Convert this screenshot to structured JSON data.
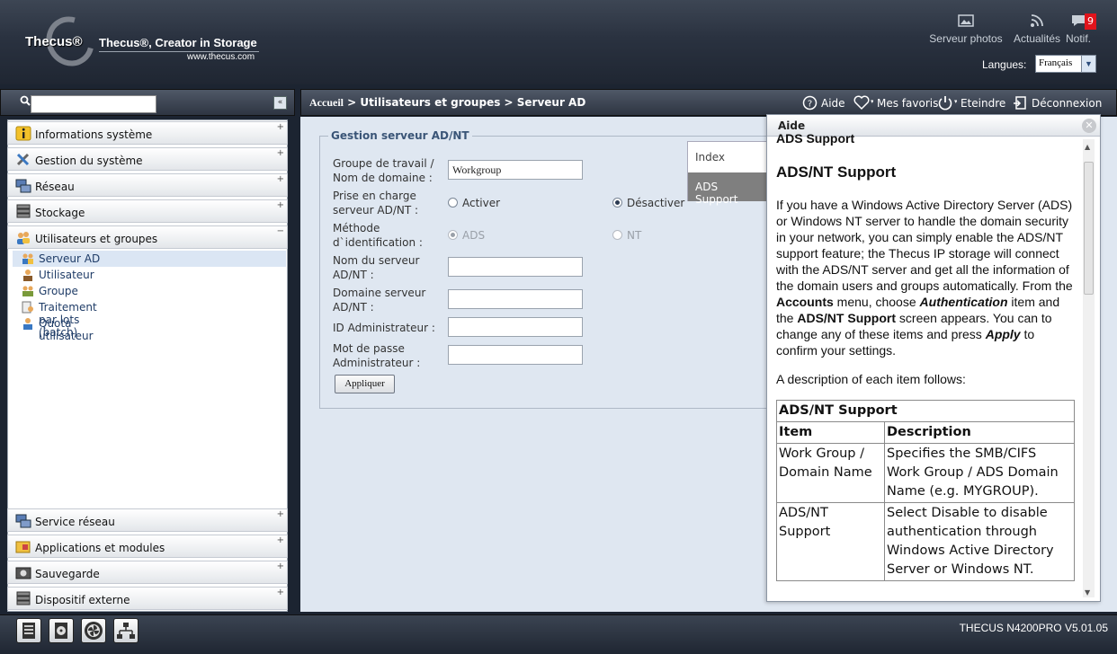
{
  "header": {
    "logo": "Thecus®",
    "tagline": "Thecus®, Creator in Storage",
    "website": "www.thecus.com",
    "photos_label": "Serveur photos",
    "news_label": "Actualités",
    "notif_label": "Notif.",
    "notif_count": "9",
    "lang_label": "Langues:",
    "lang_value": "Français"
  },
  "breadcrumb": {
    "home": "Accueil",
    "rest": " > Utilisateurs et groupes > Serveur AD"
  },
  "top_actions": {
    "help": "Aide",
    "favorites": "Mes favoris",
    "shutdown": "Eteindre",
    "logout": "Déconnexion"
  },
  "menu": {
    "items": [
      {
        "label": "Informations système",
        "sign": "+"
      },
      {
        "label": "Gestion du système",
        "sign": "+"
      },
      {
        "label": "Réseau",
        "sign": "+"
      },
      {
        "label": "Stockage",
        "sign": "+"
      },
      {
        "label": "Utilisateurs et groupes",
        "sign": "−"
      },
      {
        "label": "Service réseau",
        "sign": "+"
      },
      {
        "label": "Applications et modules",
        "sign": "+"
      },
      {
        "label": "Sauvegarde",
        "sign": "+"
      },
      {
        "label": "Dispositif externe",
        "sign": "+"
      }
    ],
    "subitems": [
      "Serveur AD",
      "Utilisateur",
      "Groupe",
      "Traitement par lots (batch)",
      "Quota utilisateur"
    ]
  },
  "form": {
    "legend": "Gestion serveur AD/NT",
    "workgroup_label": "Groupe de travail / Nom de domaine :",
    "workgroup_value": "Workgroup",
    "support_label": "Prise en charge serveur AD/NT :",
    "enable": "Activer",
    "disable": "Désactiver",
    "auth_label": "Méthode d`identification :",
    "ads": "ADS",
    "nt": "NT",
    "server_label": "Nom du serveur AD/NT :",
    "domain_label": "Domaine serveur AD/NT :",
    "admin_id_label": "ID Administrateur :",
    "admin_pw_label": "Mot de passe Administrateur :",
    "apply": "Appliquer"
  },
  "help_tabs": {
    "index": "Index",
    "ads": "ADS Support"
  },
  "help": {
    "title": "Aide",
    "partial_heading": "ADS Support",
    "heading": "ADS/NT Support",
    "p1": "If you have a Windows Active Directory Server (ADS) or Windows NT server to handle the domain security in your network, you can simply enable the ADS/NT support feature; the Thecus IP storage will connect with the ADS/NT server and get all the information of the domain users and groups automatically. From the ",
    "accounts": "Accounts",
    "p2": " menu, choose ",
    "authentication": "Authentication",
    "p3": " item and the ",
    "ads_support": "ADS/NT Support",
    "p4": " screen appears. You can to change any of these items and press ",
    "apply": "Apply",
    "p5": " to confirm your settings.",
    "desc": "A description of each item follows:",
    "table_title": "ADS/NT Support",
    "col_item": "Item",
    "col_desc": "Description",
    "row1_item": "Work Group / Domain Name",
    "row1_desc": "Specifies the SMB/CIFS Work Group / ADS Domain Name (e.g. MYGROUP).",
    "row2_item": "ADS/NT Support",
    "row2_desc": "Select Disable to disable authentication through Windows Active Directory Server or Windows NT."
  },
  "footer": {
    "version": "THECUS N4200PRO V5.01.05"
  }
}
